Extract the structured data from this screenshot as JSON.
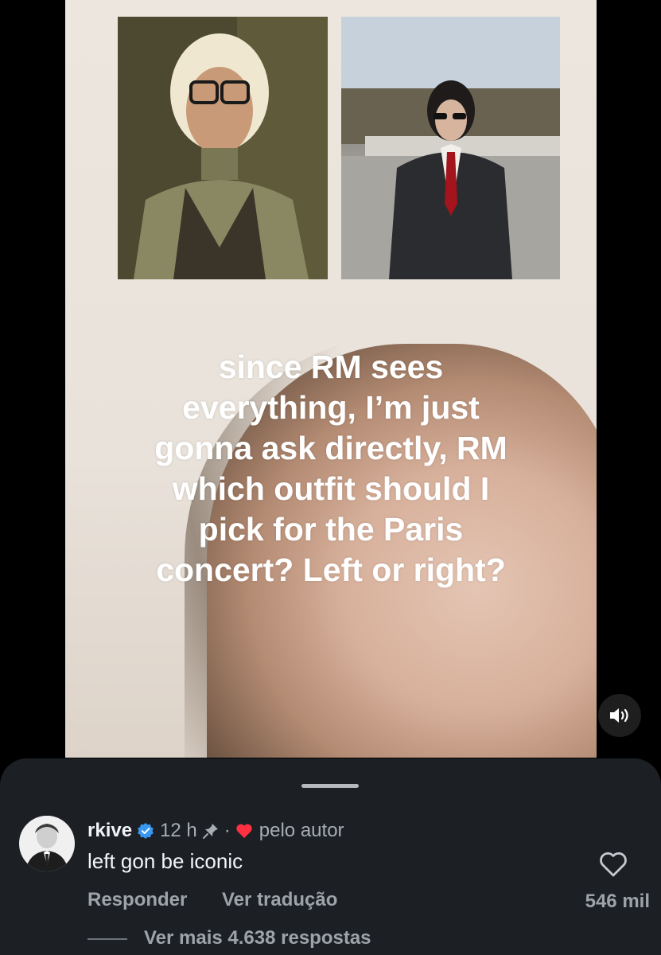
{
  "video": {
    "caption_lines": [
      "since RM sees",
      "everything, I’m just",
      "gonna ask directly, RM",
      "which outfit should I",
      "pick for the Paris",
      "concert? Left or right?"
    ],
    "photos": [
      "photo-left-outfit",
      "photo-right-outfit"
    ],
    "sound_icon": "speaker-icon"
  },
  "comment": {
    "username": "rkive",
    "verified": true,
    "time": "12 h",
    "separator": "·",
    "author_badge": "pelo autor",
    "text": "left gon be iconic",
    "reply_label": "Responder",
    "translate_label": "Ver tradução",
    "like_count": "546 mil",
    "more_replies": "Ver mais 4.638 respostas"
  },
  "colors": {
    "sheet_bg": "#1c2025",
    "verified_blue": "#3897f0",
    "heart_red": "#ff3040"
  }
}
